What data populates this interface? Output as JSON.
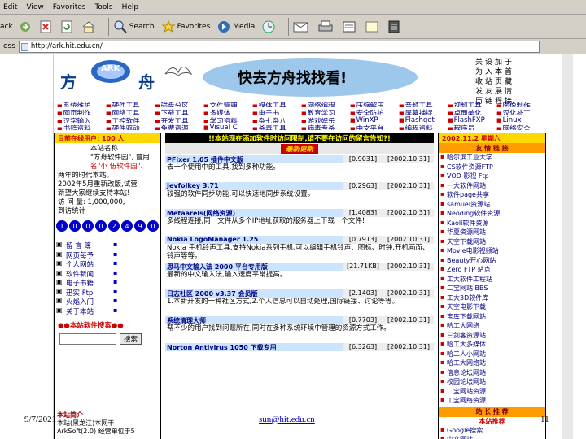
{
  "menu": [
    "Edit",
    "View",
    "Favorites",
    "Tools",
    "Help"
  ],
  "toolbar": {
    "back": "ack",
    "search": "Search",
    "favorites": "Favorites",
    "media": "Media"
  },
  "address": {
    "label": "ess",
    "url": "http://ark.hit.edu.cn/"
  },
  "site": {
    "logo_left": "方",
    "logo_mid": "ARK",
    "logo_right": "舟",
    "slogan": "快去方舟找找看!",
    "corner_links": [
      "关",
      "设",
      "加",
      "于",
      "为",
      "入",
      "本",
      "首",
      "收",
      "站",
      "页",
      "藏",
      "发",
      "友",
      "展",
      "情",
      "历",
      "链",
      "程",
      "接"
    ]
  },
  "nav": [
    "系统维护",
    "硬件工具",
    "磁盘分区",
    "文件管理",
    "媒体工具",
    "网络编程",
    "压缩解压",
    "音频工具",
    "视频工具",
    "图像制作",
    "网页制作",
    "网络工具",
    "下载工具",
    "多媒体",
    "电子书",
    "教育学习",
    "安全防护",
    "屏幕捕捉",
    "桌面美化",
    "汉化补丁",
    "汉字输入",
    "工控软件",
    "开发工具",
    "学习资料",
    "杂七杂八",
    "游戏娱乐",
    "WinXP",
    "Flashget",
    "FlashFXP",
    "Linux",
    "书籍资料",
    "硬件驱动",
    "免费资源",
    "Visual C",
    "杀毒工具",
    "病毒专杀",
    "中文平台",
    "编程资料",
    "程序员",
    "网络安全"
  ],
  "left": {
    "counter": "目前在线用户: 100 人",
    "intro_title": "本站名称",
    "intro1": "\"方舟软件园\", 曾用",
    "intro2": "名\"小 伍软件园\".",
    "intro3": "两年的时代本站。",
    "intro4": "2002年5月重新改版,试营",
    "intro5": "新望大家继续支持本站!",
    "visits_label": "访 问 量: 1,000,000,",
    "counter_label": "到访统计",
    "digits": [
      "1",
      "0",
      "0",
      "0",
      "2",
      "4",
      "9",
      "0"
    ],
    "list": [
      "留 言 簿",
      "网页每予",
      "个人网站",
      "软件新闻",
      "电子书籍",
      "迅实 Ftp",
      "火焰入门",
      "关于本站"
    ],
    "search_label": "●●本站软件搜索●●",
    "search_button": "搜索",
    "bottom1": "本站简介",
    "bottom2": "本站(黑龙江)本网干",
    "bottom3": "ArkSoft(2.0) 经营单位于5"
  },
  "mid": {
    "notice": "!!本站现在添加软件时访问限制,请不要在访问的留言告知?!",
    "tag": "最新更新",
    "items": [
      {
        "name": "PFixer 1.05 插件中文版",
        "size": "[0.9031]",
        "date": "[2002.10.31]",
        "desc": "去一个使用中的工具,找到多种功能。"
      },
      {
        "name": "Jevfolkey 3.71",
        "size": "[0.2963]",
        "date": "[2002.10.31]",
        "desc": "较强的软件同步功能,可以快速地同步系统设置。"
      },
      {
        "name": "Metaarels(网络资源)",
        "size": "[1.4083]",
        "date": "[2002.10.31]",
        "desc": "多线程连接,同一文件从多个IP地址获取的服务器上下载一个文件!"
      },
      {
        "name": "Nokia LogoManager 1.25",
        "size": "[0.7913]",
        "date": "[2002.10.31]",
        "desc": "Nokia 手机铃声工具,支持Nokia系列手机,可以编辑手机铃声、图标、时钟,开机画面、铃声等等。"
      },
      {
        "name": "思马中文输入法 2000 平台专用版",
        "size": "[21.71KB]",
        "date": "[2002.10.31]",
        "desc": "最新的中文输入法,输入速度平常提高。"
      },
      {
        "name": "日志社区 2000 v3.37 会员版",
        "size": "[2.1403]",
        "date": "[2002.10.31]",
        "desc": "1.本新开发的一种社区方式,2.个人信息可以自动处理,国际链接、讨论等等。"
      },
      {
        "name": "系统清理大师",
        "size": "[0.7703]",
        "date": "[2002.10.31]",
        "desc": "帮不少的用户找到问题所在,同时在多种系统环境中管理的资源方式工作。"
      },
      {
        "name": "Norton Antivirus 1050 下载专用",
        "size": "[6.3263]",
        "date": "[2002.10.31]",
        "desc": ""
      }
    ]
  },
  "right": {
    "header": "2002.11.2 星期六",
    "friends_title": "友 情 链 接",
    "friends": [
      "哈尔滨工业大学",
      "CS软件资源FTP",
      "VOD 影视 Ftp",
      "一大软件网站",
      "软件page共享",
      "samuel资源站",
      "Neoding软件资源",
      "Kaoli软件资源",
      "华夏资源网站",
      "天空下载网站",
      "Movie电影视频站",
      "Beauty开心网站",
      "Zero FTP 站点",
      "工大软件工程站",
      "二宝网站 BBS",
      "工大3D软件库",
      "天空电影下载",
      "宝库下载网站",
      "哈工大网络",
      "三剑客资源站",
      "哈工大多媒体",
      "哈二人小网站",
      "哈工大网络站",
      "信息论坛网站",
      "校园论坛网站",
      "二宝网站资源",
      "工宝网络资源"
    ],
    "rec_title": "站 长 推 荐",
    "rec_sub": "本站推荐",
    "rec_list": [
      "Google搜索",
      "中文网站"
    ]
  },
  "footer": {
    "date": "9/7/2021",
    "email": "sun@hit.edu.cn",
    "page": "11"
  }
}
